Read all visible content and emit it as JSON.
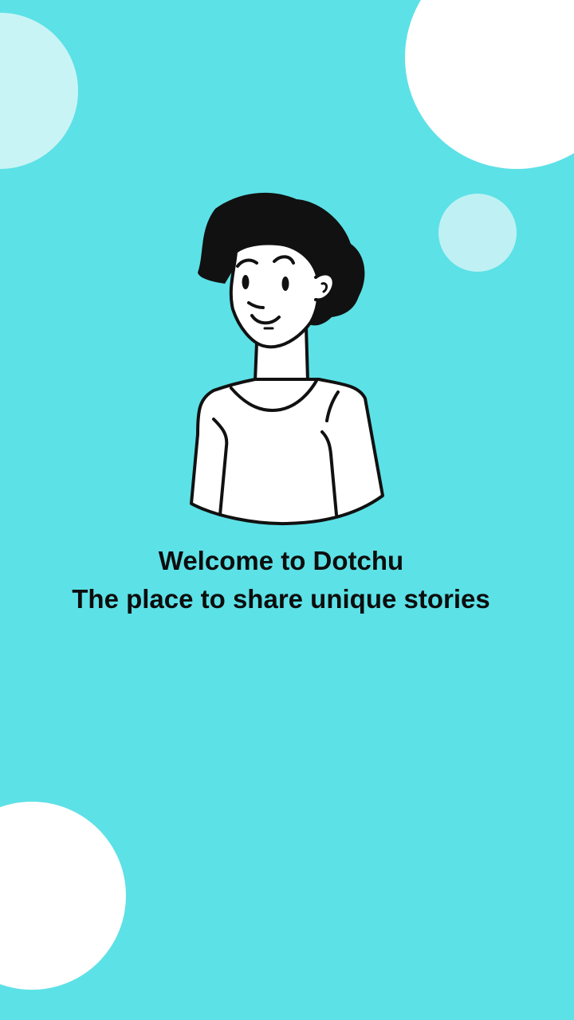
{
  "theme": {
    "background": "#5ce1e6",
    "bubble_light": "#c9f4f6",
    "bubble_white": "#ffffff",
    "text": "#0d0d0d"
  },
  "welcome": {
    "title": "Welcome to Dotchu",
    "tagline": "The place to share unique stories"
  },
  "illustration": {
    "icon": "person-illustration-icon"
  }
}
